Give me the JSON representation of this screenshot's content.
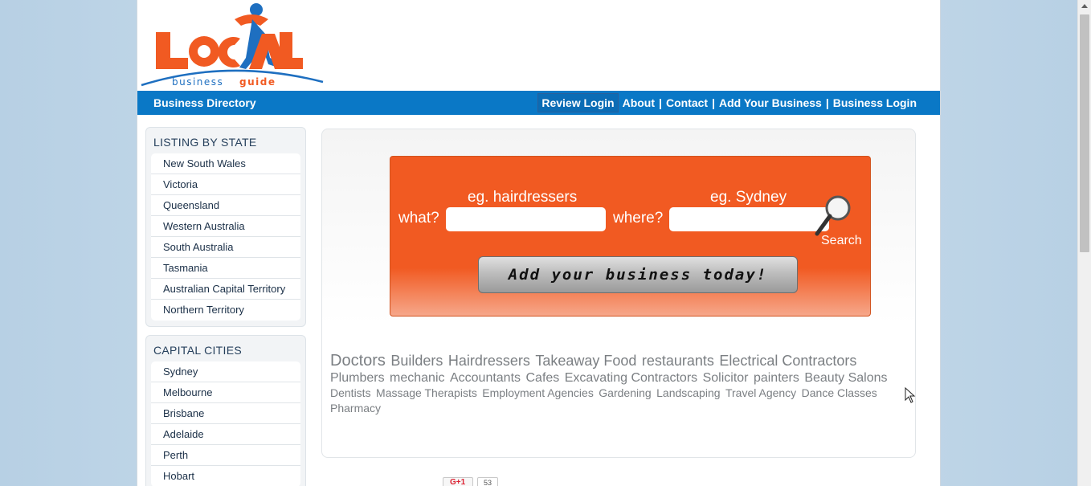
{
  "logo": {
    "word": "LOCAL",
    "tagline_a": "business",
    "tagline_b": "guide"
  },
  "navbar": {
    "brand": "Business Directory",
    "review_login": "Review Login",
    "links": [
      "About",
      "Contact",
      "Add Your Business",
      "Business Login"
    ],
    "separator": "|",
    "color": "#0a78c6"
  },
  "state_box": {
    "title": "LISTING BY STATE",
    "items": [
      "New South Wales",
      "Victoria",
      "Queensland",
      "Western Australia",
      "South Australia",
      "Tasmania",
      "Australian Capital Territory",
      "Northern Territory"
    ]
  },
  "cities_box": {
    "title": "CAPITAL CITIES",
    "items": [
      "Sydney",
      "Melbourne",
      "Brisbane",
      "Adelaide",
      "Perth",
      "Hobart"
    ]
  },
  "search": {
    "what_label": "what?",
    "what_hint": "eg. hairdressers",
    "what_value": "",
    "where_label": "where?",
    "where_hint": "eg. Sydney",
    "where_value": "",
    "search_label": "Search",
    "search_icon": "magnifier-icon",
    "add_button": "Add your business today!",
    "color": "#f15a22"
  },
  "tags": {
    "line1": [
      "Doctors",
      "Builders",
      "Hairdressers",
      "Takeaway Food",
      "restaurants",
      "Electrical Contractors"
    ],
    "line2": [
      "Plumbers",
      "mechanic",
      "Accountants",
      "Cafes",
      "Excavating Contractors",
      "Solicitor",
      "painters",
      "Beauty Salons"
    ],
    "line3": [
      "Dentists",
      "Massage Therapists",
      "Employment Agencies",
      "Gardening",
      "Landscaping",
      "Travel Agency",
      "Dance Classes"
    ],
    "line4": [
      "Pharmacy"
    ]
  },
  "social": {
    "gplus_label": "G+1",
    "gplus_count": "53"
  }
}
